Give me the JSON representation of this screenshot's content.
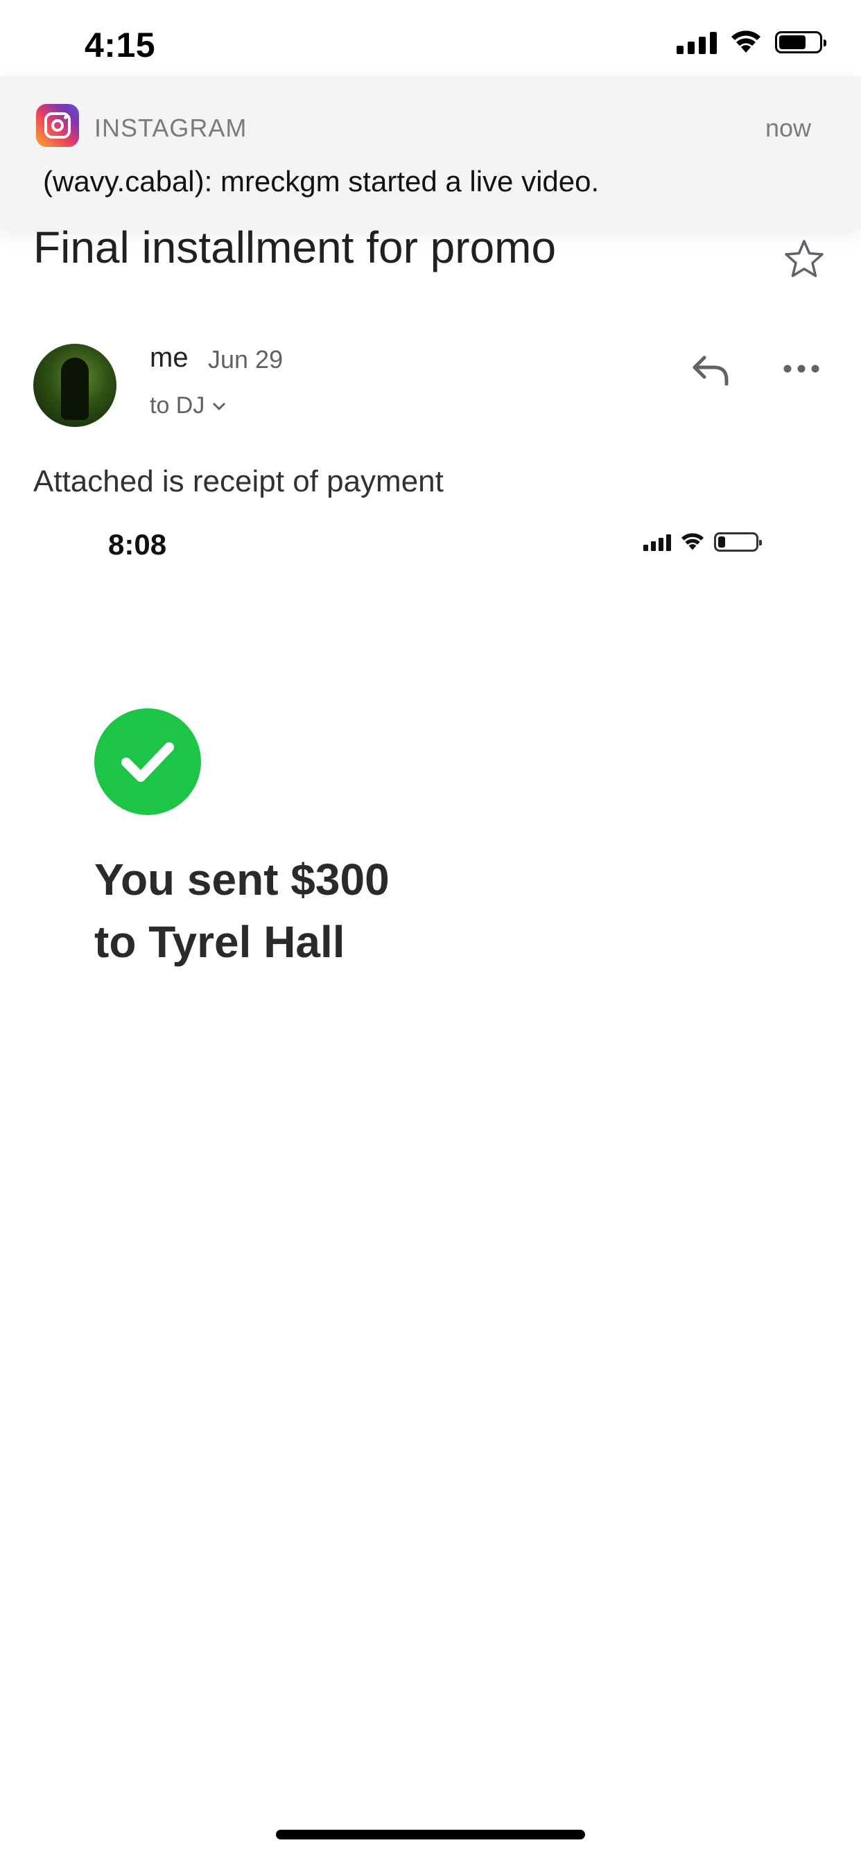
{
  "status_bar": {
    "time": "4:15"
  },
  "notification": {
    "app_name": "INSTAGRAM",
    "time": "now",
    "message": "(wavy.cabal): mreckgm started a live video."
  },
  "email": {
    "subject": "Final installment for promo",
    "sender": "me",
    "date": "Jun 29",
    "recipient": "to DJ",
    "body": "Attached is receipt of payment"
  },
  "attachment": {
    "status_time": "8:08",
    "payment_line1": "You sent $300",
    "payment_line2": "to Tyrel Hall",
    "success_color": "#1cc545"
  },
  "icons": [
    "instagram-icon",
    "star-icon",
    "reply-icon",
    "more-icon",
    "chevron-down-icon",
    "check-icon",
    "signal-icon",
    "wifi-icon",
    "battery-icon"
  ]
}
